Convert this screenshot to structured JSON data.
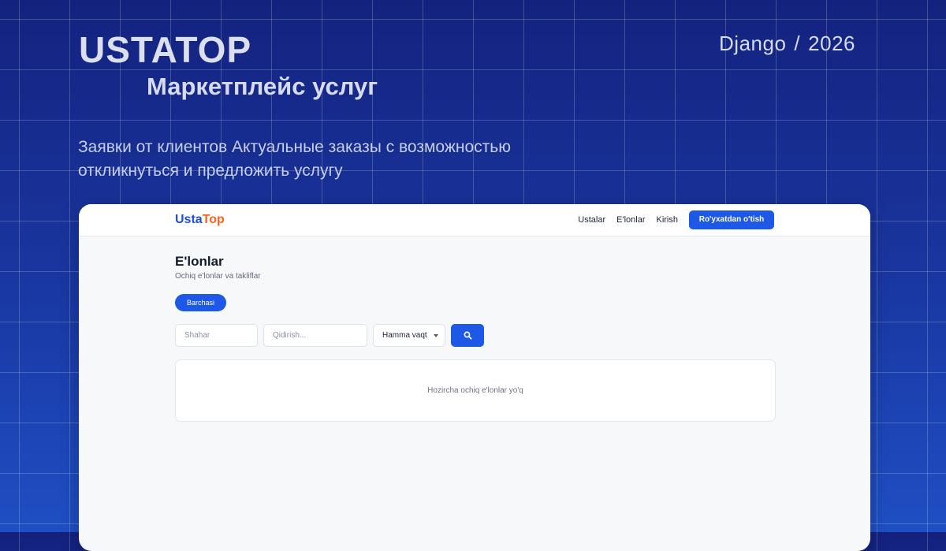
{
  "slide": {
    "title": "USTATOP",
    "subtitle": "Маркетплейс услуг",
    "tech": "Django",
    "separator": "/",
    "year": "2026",
    "description": "Заявки от клиентов Актуальные заказы с возможностью откликнуться и предложить услугу"
  },
  "app": {
    "logo": {
      "part1": "Usta",
      "part2": "Top"
    },
    "nav": {
      "links": [
        "Ustalar",
        "E'lonlar",
        "Kirish"
      ],
      "register_label": "Ro'yxatdan o'tish"
    },
    "page": {
      "title": "E'lonlar",
      "subtitle": "Ochiq e'lonlar va takliflar",
      "filter_active": "Barchasi"
    },
    "search": {
      "city_placeholder": "Shahar",
      "query_placeholder": "Qidirish...",
      "time_selected": "Hamma vaqt",
      "search_icon": "search-icon"
    },
    "empty_message": "Hozircha ochiq e'lonlar yo'q"
  },
  "colors": {
    "accent": "#1d58e6",
    "logo_blue": "#1d4fd8",
    "logo_orange": "#f2661f",
    "background": "#13268a"
  }
}
